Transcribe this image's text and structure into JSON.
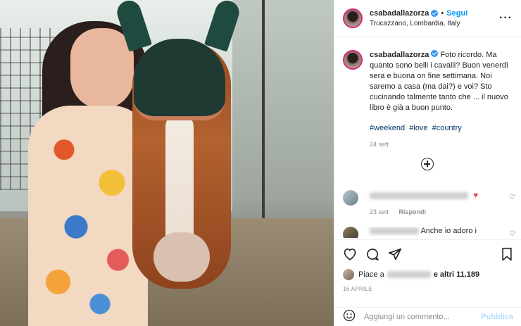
{
  "header": {
    "username": "csabadallazorza",
    "follow_label": "Segui",
    "location": "Trucazzano, Lombardia, Italy",
    "separator": "•",
    "more_label": "···"
  },
  "caption": {
    "username": "csabadallazorza",
    "text": "Foto ricordo. Ma quanto sono belli i cavalli? Buon venerdì sera e buona on fine settimana. Noi saremo a casa (ma dai?) e voi? Sto cucinando talmente tanto che ... il nuovo libro è già a buon punto.",
    "hashtags": [
      "#weekend",
      "#love",
      "#country"
    ],
    "date": "24 sett"
  },
  "comments": [
    {
      "date": "23 sett",
      "reply_label": "Rispondi",
      "emoji": "♥"
    },
    {
      "text": "Anche io adoro i"
    }
  ],
  "likes": {
    "prefix": "Piace a",
    "suffix": "e altri 11.189"
  },
  "post_date": "16 APRILE",
  "add_comment": {
    "placeholder": "Aggiungi un commento...",
    "publish_label": "Pubblica"
  },
  "colors": {
    "accent": "#0095f6",
    "verified": "#3897f0",
    "heart": "#ed4956"
  },
  "icons": [
    "heart-icon",
    "comment-icon",
    "share-icon",
    "bookmark-icon",
    "plus-circle-icon",
    "emoji-icon",
    "verified-icon"
  ]
}
